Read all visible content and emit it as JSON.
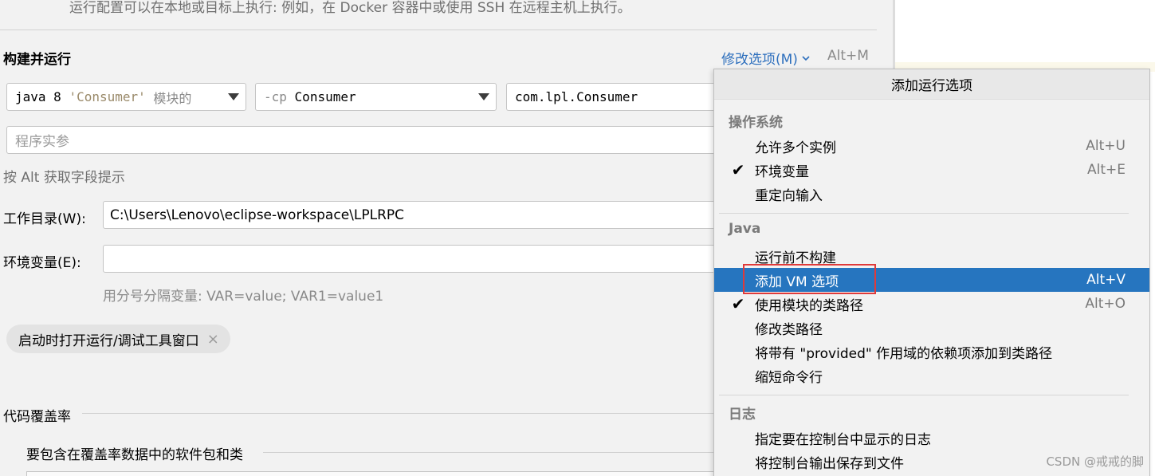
{
  "description": "运行配置可以在本地或目标上执行: 例如，在 Docker 容器中或使用 SSH 在远程主机上执行。",
  "build_run": {
    "title": "构建并运行",
    "modify_options": "修改选项(M)",
    "modify_shortcut": "Alt+M",
    "jre": {
      "prefix": "java 8",
      "module": "'Consumer'",
      "suffix": "模块的"
    },
    "classpath": {
      "flag": "-cp",
      "value": "Consumer"
    },
    "main_class": "com.lpl.Consumer",
    "args_placeholder": "程序实参",
    "alt_hint": "按 Alt 获取字段提示"
  },
  "working_dir": {
    "label": "工作目录(W):",
    "value": "C:\\Users\\Lenovo\\eclipse-workspace\\LPLRPC"
  },
  "env_vars": {
    "label": "环境变量(E):",
    "value": "",
    "hint": "用分号分隔变量: VAR=value; VAR1=value1"
  },
  "chip": {
    "label": "启动时打开运行/调试工具窗口",
    "close": "×"
  },
  "coverage": {
    "title": "代码覆盖率",
    "subtitle": "要包含在覆盖率数据中的软件包和类"
  },
  "popup": {
    "title": "添加运行选项",
    "groups": [
      {
        "title": "操作系统"
      },
      {
        "title": "Java"
      },
      {
        "title": "日志"
      }
    ],
    "items": [
      {
        "label": "允许多个实例",
        "shortcut": "Alt+U",
        "check": ""
      },
      {
        "label": "环境变量",
        "shortcut": "Alt+E",
        "check": "✔"
      },
      {
        "label": "重定向输入",
        "shortcut": "",
        "check": ""
      },
      {
        "label": "运行前不构建",
        "shortcut": "",
        "check": ""
      },
      {
        "label": "添加 VM 选项",
        "shortcut": "Alt+V",
        "check": ""
      },
      {
        "label": "使用模块的类路径",
        "shortcut": "Alt+O",
        "check": "✔"
      },
      {
        "label": "修改类路径",
        "shortcut": "",
        "check": ""
      },
      {
        "label": "将带有 \"provided\" 作用域的依赖项添加到类路径",
        "shortcut": "",
        "check": ""
      },
      {
        "label": "缩短命令行",
        "shortcut": "",
        "check": ""
      },
      {
        "label": "指定要在控制台中显示的日志",
        "shortcut": "",
        "check": ""
      },
      {
        "label": "将控制台输出保存到文件",
        "shortcut": "",
        "check": ""
      }
    ],
    "selected_item": "添加 VM 选项"
  },
  "watermark": "CSDN @戒戒的脚",
  "colors": {
    "accent": "#2675bf",
    "link": "#2d6fbd",
    "highlight_border": "#e03a3a"
  }
}
